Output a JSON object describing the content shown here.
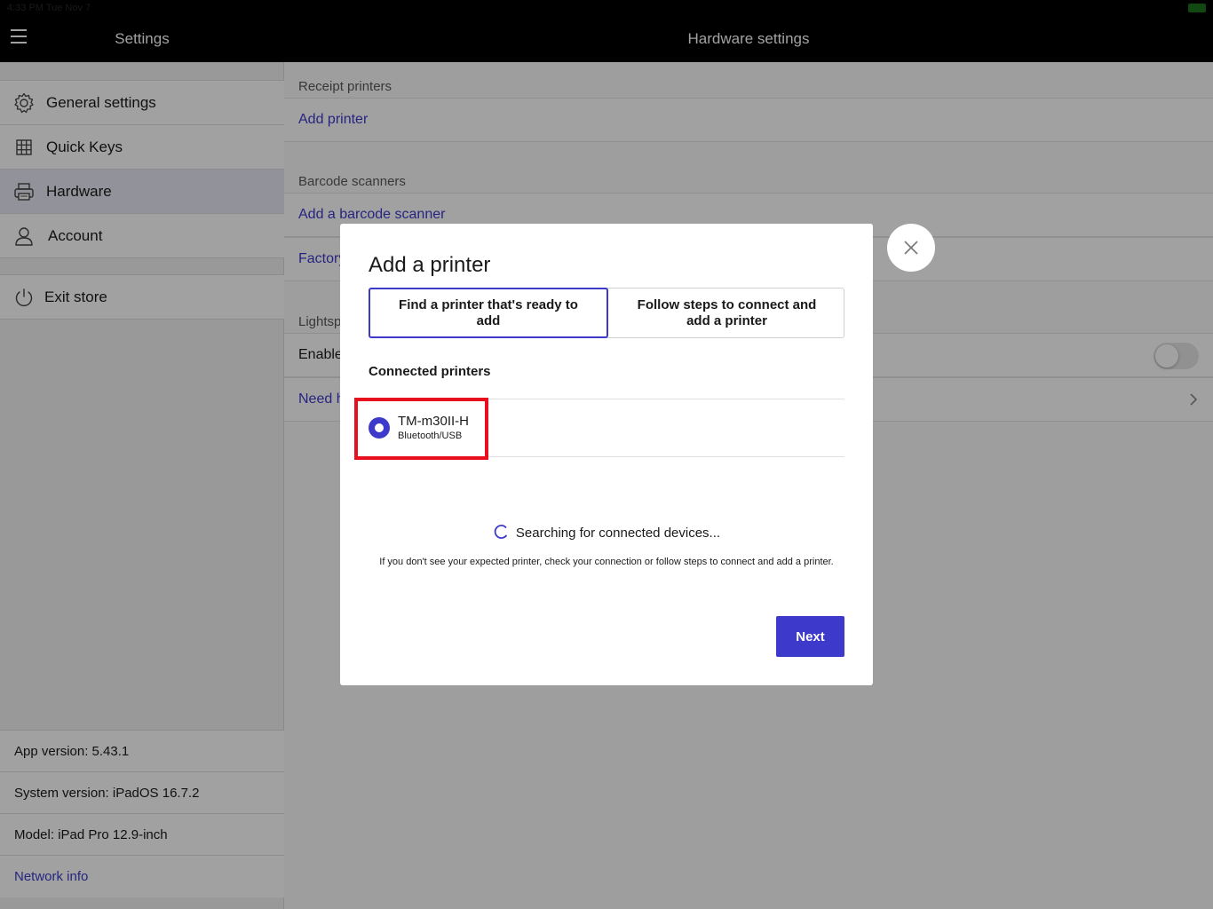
{
  "status_bar": {
    "time": "4:33 PM",
    "date": "Tue Nov 7",
    "battery": "100%"
  },
  "sidebar": {
    "title": "Settings",
    "items": [
      {
        "label": "General settings",
        "icon": "gear-icon"
      },
      {
        "label": "Quick Keys",
        "icon": "grid-icon"
      },
      {
        "label": "Hardware",
        "icon": "printer-icon",
        "selected": true
      },
      {
        "label": "Account",
        "icon": "user-icon"
      }
    ],
    "exit_label": "Exit store",
    "info": {
      "app_version": "App version: 5.43.1",
      "system_version": "System version: iPadOS 16.7.2",
      "model": "Model: iPad Pro 12.9-inch",
      "network_link": "Network info"
    }
  },
  "main": {
    "title": "Hardware settings",
    "receipt_printers_label": "Receipt printers",
    "add_printer": "Add printer",
    "barcode_scanners_label": "Barcode scanners",
    "add_barcode_scanner": "Add a barcode scanner",
    "factory_partial": "Factory",
    "lightspeed_partial": "Lightsp",
    "enable_partial": "Enable",
    "need_help_partial": "Need h"
  },
  "modal": {
    "title": "Add a printer",
    "tab_find": "Find a printer that's ready to add",
    "tab_follow": "Follow steps to connect and add a printer",
    "connected_label": "Connected printers",
    "printers": [
      {
        "name": "TM-m30II-H",
        "connection": "Bluetooth/USB",
        "selected": true
      }
    ],
    "searching_text": "Searching for connected devices...",
    "hint": "If you don't see your expected printer, check your connection or follow steps to connect and add a printer.",
    "next_label": "Next"
  },
  "colors": {
    "accent": "#3d3acb",
    "highlight": "#e8101e",
    "topbar": "#000000"
  }
}
